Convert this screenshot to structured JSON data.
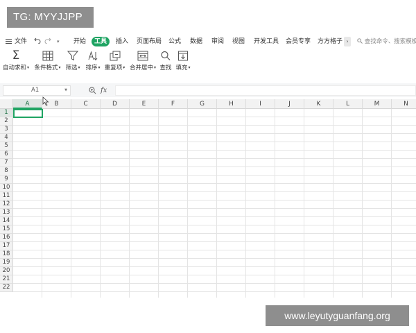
{
  "overlay_tag": "TG: MYYJJPP",
  "watermark": "www.leyutyguanfang.org",
  "menubar": {
    "file_label": "文件",
    "tabs": [
      "开始",
      "工具",
      "插入",
      "页面布局",
      "公式",
      "数据",
      "审阅",
      "视图",
      "开发工具",
      "会员专享",
      "方方格子"
    ],
    "active_tab": "工具",
    "more": "›",
    "search_placeholder": "查找命令、搜索模板"
  },
  "toolbar": {
    "autosum": "自动求和",
    "conditional_format": "条件格式",
    "filter": "筛选",
    "sort": "排序",
    "duplicates": "重复项",
    "merge_center": "合并居中",
    "find": "查找",
    "fill": "填充",
    "dropdown_mark": "▾"
  },
  "formula_bar": {
    "name_box": "A1",
    "fx_label": "fx",
    "formula_value": ""
  },
  "sheet": {
    "columns": [
      "A",
      "B",
      "C",
      "D",
      "E",
      "F",
      "G",
      "H",
      "I",
      "J",
      "K",
      "L",
      "M",
      "N"
    ],
    "rows": [
      "1",
      "2",
      "3",
      "4",
      "5",
      "6",
      "7",
      "8",
      "9",
      "10",
      "11",
      "12",
      "13",
      "14",
      "15",
      "16",
      "17",
      "18",
      "19",
      "20",
      "21",
      "22"
    ],
    "selected_cell": "A1"
  },
  "colors": {
    "accent": "#1fa463",
    "overlay": "#8e8e8e"
  }
}
